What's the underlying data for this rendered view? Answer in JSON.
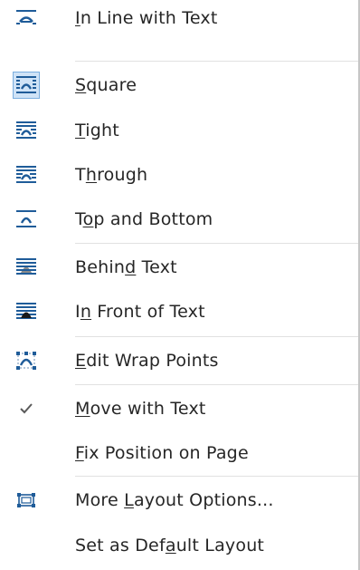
{
  "menu": {
    "items": [
      {
        "name": "in-line-with-text",
        "pre": "",
        "key": "I",
        "post": "n Line with Text",
        "icon": "wrap-inline-icon",
        "selected": false
      },
      {
        "name": "square",
        "pre": "",
        "key": "S",
        "post": "quare",
        "icon": "wrap-square-icon",
        "selected": true
      },
      {
        "name": "tight",
        "pre": "",
        "key": "T",
        "post": "ight",
        "icon": "wrap-tight-icon",
        "selected": false
      },
      {
        "name": "through",
        "pre": "T",
        "key": "h",
        "post": "rough",
        "icon": "wrap-through-icon",
        "selected": false
      },
      {
        "name": "top-and-bottom",
        "pre": "T",
        "key": "o",
        "post": "p and Bottom",
        "icon": "wrap-top-bottom-icon",
        "selected": false
      },
      {
        "name": "behind-text",
        "pre": "Behin",
        "key": "d",
        "post": " Text",
        "icon": "wrap-behind-text-icon",
        "selected": false
      },
      {
        "name": "in-front-of-text",
        "pre": "I",
        "key": "n",
        "post": " Front of Text",
        "icon": "wrap-in-front-icon",
        "selected": false
      },
      {
        "name": "edit-wrap-points",
        "pre": "",
        "key": "E",
        "post": "dit Wrap Points",
        "icon": "edit-wrap-points-icon",
        "selected": false
      },
      {
        "name": "move-with-text",
        "pre": "",
        "key": "M",
        "post": "ove with Text",
        "icon": "checkmark-icon",
        "selected": false,
        "checked": true
      },
      {
        "name": "fix-position-on-page",
        "pre": "",
        "key": "F",
        "post": "ix Position on Page",
        "icon": "",
        "selected": false
      },
      {
        "name": "more-layout-options",
        "pre": "More ",
        "key": "L",
        "post": "ayout Options...",
        "icon": "layout-options-icon",
        "selected": false
      },
      {
        "name": "set-as-default-layout",
        "pre": "Set as Def",
        "key": "a",
        "post": "ult Layout",
        "icon": "",
        "selected": false
      }
    ]
  },
  "colors": {
    "icon_blue": "#1f5c99",
    "icon_gray": "#8a8a8a",
    "selected_bg": "#cfe3f7",
    "selected_border": "#7aaedf",
    "text": "#262626",
    "separator": "#e1e1e1"
  }
}
